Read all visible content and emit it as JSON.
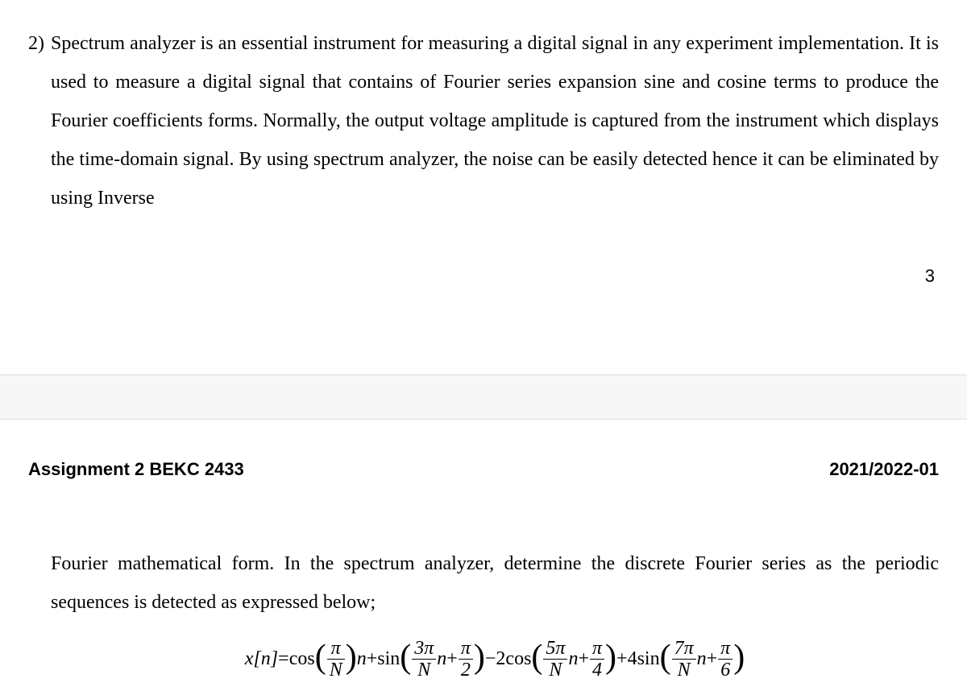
{
  "question": {
    "number": "2)",
    "intro_text": "Spectrum analyzer is an essential instrument for measuring a digital signal in any experiment implementation. It is used to measure a digital signal that contains of Fourier series expansion sine and cosine terms to produce the Fourier coefficients forms. Normally, the output voltage amplitude is captured from the instrument which displays the time-domain signal. By using spectrum analyzer, the noise can be easily detected hence it can be eliminated by using Inverse",
    "continuation_text": "Fourier mathematical form. In the spectrum analyzer, determine the discrete Fourier series as the periodic sequences is detected as expressed below;"
  },
  "page_number": "3",
  "assignment": {
    "title": "Assignment 2 BEKC 2433",
    "term": "2021/2022-01"
  },
  "equation": {
    "lhs": "x[n]",
    "eq": " = ",
    "terms": [
      {
        "coef": "",
        "func": "cos",
        "num": "π",
        "den": "N",
        "mult": "n",
        "phase_num": "",
        "phase_den": ""
      },
      {
        "op": " + ",
        "coef": "",
        "func": "sin",
        "num": "3π",
        "den": "N",
        "mult": "n",
        "op2": " + ",
        "phase_num": "π",
        "phase_den": "2"
      },
      {
        "op": " − ",
        "coef": "2 ",
        "func": "cos",
        "num": "5π",
        "den": "N",
        "mult": "n",
        "op2": " + ",
        "phase_num": "π",
        "phase_den": "4"
      },
      {
        "op": " + ",
        "coef": "4 ",
        "func": "sin",
        "num": "7π",
        "den": "N",
        "mult": "n",
        "op2": " + ",
        "phase_num": "π",
        "phase_den": "6"
      }
    ]
  }
}
